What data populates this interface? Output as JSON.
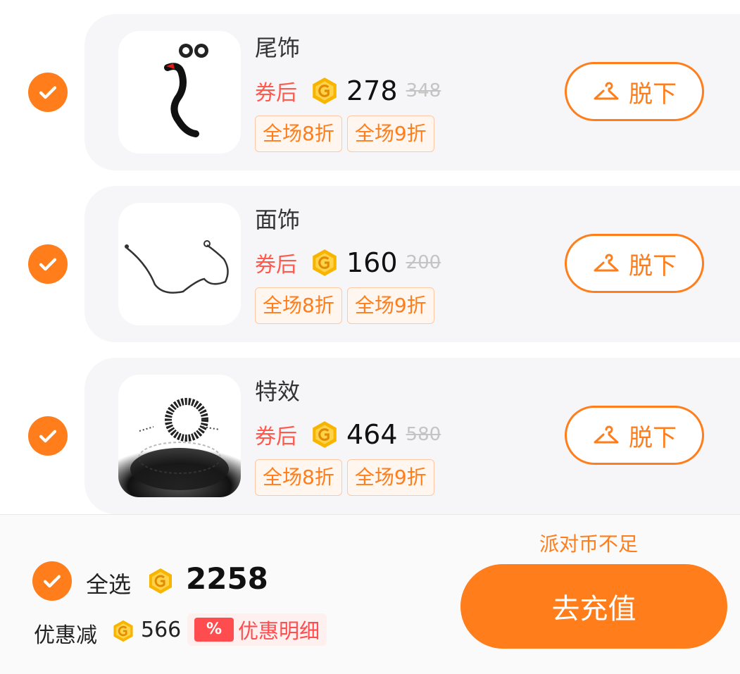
{
  "items": [
    {
      "name": "尾饰",
      "after_coupon_label": "券后",
      "price": "278",
      "original_price": "348",
      "tags": [
        "全场8折",
        "全场9折"
      ],
      "action_label": "脱下",
      "thumb_icon": "tail-accessory-image"
    },
    {
      "name": "面饰",
      "after_coupon_label": "券后",
      "price": "160",
      "original_price": "200",
      "tags": [
        "全场8折",
        "全场9折"
      ],
      "action_label": "脱下",
      "thumb_icon": "glasses-accessory-image"
    },
    {
      "name": "特效",
      "after_coupon_label": "券后",
      "price": "464",
      "original_price": "580",
      "tags": [
        "全场8折",
        "全场9折"
      ],
      "action_label": "脱下",
      "thumb_icon": "effect-image"
    }
  ],
  "footer": {
    "warning": "派对币不足",
    "select_all_label": "全选",
    "total": "2258",
    "discount_label": "优惠减",
    "discount_value": "566",
    "discount_badge": "%",
    "discount_detail_label": "优惠明细",
    "recharge_label": "去充值"
  },
  "colors": {
    "accent": "#ff7d1a",
    "coupon_red": "#ff5a4e",
    "coin_gold": "#f7b500",
    "card_bg": "#f6f6f8"
  }
}
